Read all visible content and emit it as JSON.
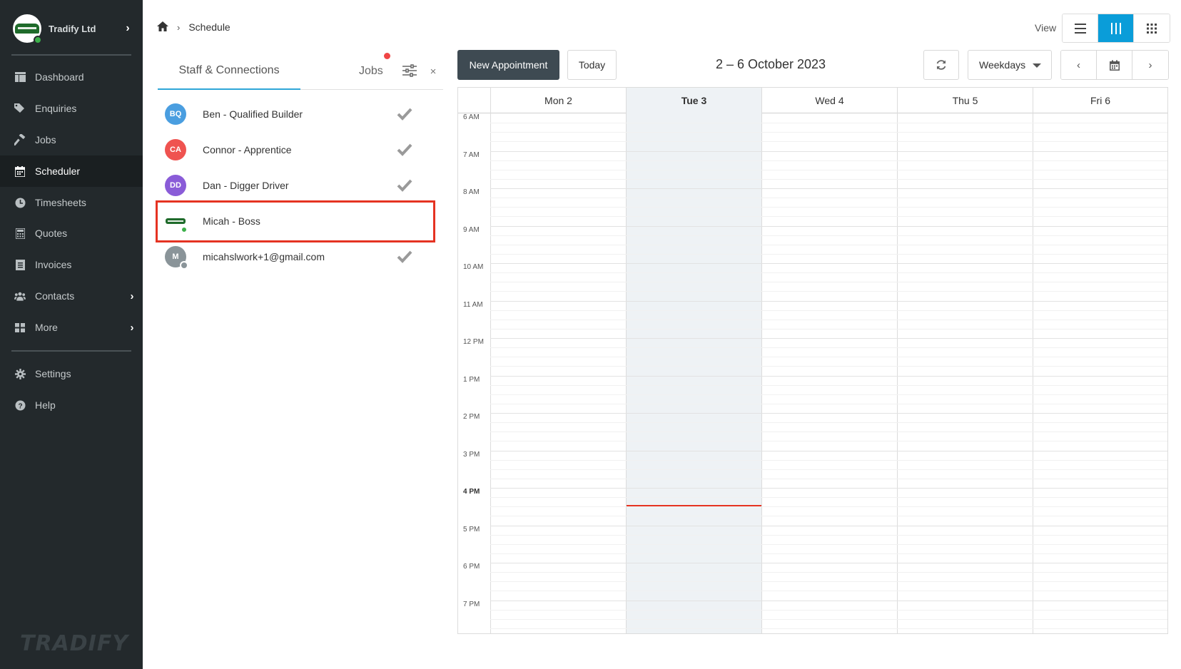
{
  "sidebar": {
    "company_name": "Tradify Ltd",
    "items": [
      {
        "label": "Dashboard",
        "icon": "dashboard-icon"
      },
      {
        "label": "Enquiries",
        "icon": "tag-icon"
      },
      {
        "label": "Jobs",
        "icon": "hammer-icon"
      },
      {
        "label": "Scheduler",
        "icon": "calendar-icon",
        "active": true
      },
      {
        "label": "Timesheets",
        "icon": "clock-icon"
      },
      {
        "label": "Quotes",
        "icon": "calculator-icon"
      },
      {
        "label": "Invoices",
        "icon": "invoice-icon"
      },
      {
        "label": "Contacts",
        "icon": "users-icon"
      },
      {
        "label": "More",
        "icon": "grid-icon"
      },
      {
        "label": "Settings",
        "icon": "gear-icon"
      },
      {
        "label": "Help",
        "icon": "help-icon"
      }
    ],
    "brand": "TRADIFY"
  },
  "header": {
    "breadcrumb": "Schedule",
    "view_label": "View",
    "view_options": [
      "list",
      "week",
      "month"
    ],
    "active_view": "week"
  },
  "panel": {
    "tab_staff": "Staff & Connections",
    "tab_jobs": "Jobs",
    "close": "×",
    "staff": [
      {
        "initials": "BQ",
        "name": "Ben - Qualified Builder",
        "color": "#4a9ee0",
        "checked": true
      },
      {
        "initials": "CA",
        "name": "Connor - Apprentice",
        "color": "#ef5350",
        "checked": true
      },
      {
        "initials": "DD",
        "name": "Dan - Digger Driver",
        "color": "#8a5cd8",
        "checked": true
      },
      {
        "initials": "",
        "name": "Micah - Boss",
        "color": "#ffffff",
        "checked": false
      },
      {
        "initials": "M",
        "name": "micahslwork+1@gmail.com",
        "color": "#8a9499",
        "checked": true
      }
    ]
  },
  "toolbar": {
    "new_appointment": "New Appointment",
    "today": "Today",
    "date_range": "2 – 6 October 2023",
    "range_select": "Weekdays",
    "prev": "‹",
    "next": "›"
  },
  "calendar": {
    "days": [
      {
        "label": "Mon 2",
        "today": false
      },
      {
        "label": "Tue 3",
        "today": true
      },
      {
        "label": "Wed 4",
        "today": false
      },
      {
        "label": "Thu 5",
        "today": false
      },
      {
        "label": "Fri 6",
        "today": false
      }
    ],
    "hours": [
      "6 AM",
      "7 AM",
      "8 AM",
      "9 AM",
      "10 AM",
      "11 AM",
      "12 PM",
      "1 PM",
      "2 PM",
      "3 PM",
      "4 PM",
      "5 PM",
      "6 PM",
      "7 PM"
    ],
    "current_hour_label": "4 PM",
    "now_time": "4:27 PM",
    "colors": {
      "accent": "#0a9dd9",
      "now_line": "#e53322",
      "today_bg": "#eef2f5"
    }
  }
}
